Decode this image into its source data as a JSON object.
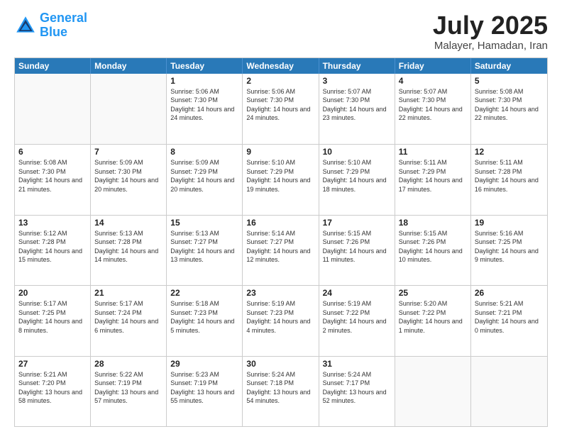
{
  "logo": {
    "line1": "General",
    "line2": "Blue"
  },
  "title": "July 2025",
  "location": "Malayer, Hamadan, Iran",
  "header_days": [
    "Sunday",
    "Monday",
    "Tuesday",
    "Wednesday",
    "Thursday",
    "Friday",
    "Saturday"
  ],
  "weeks": [
    [
      {
        "day": "",
        "info": ""
      },
      {
        "day": "",
        "info": ""
      },
      {
        "day": "1",
        "info": "Sunrise: 5:06 AM\nSunset: 7:30 PM\nDaylight: 14 hours and 24 minutes."
      },
      {
        "day": "2",
        "info": "Sunrise: 5:06 AM\nSunset: 7:30 PM\nDaylight: 14 hours and 24 minutes."
      },
      {
        "day": "3",
        "info": "Sunrise: 5:07 AM\nSunset: 7:30 PM\nDaylight: 14 hours and 23 minutes."
      },
      {
        "day": "4",
        "info": "Sunrise: 5:07 AM\nSunset: 7:30 PM\nDaylight: 14 hours and 22 minutes."
      },
      {
        "day": "5",
        "info": "Sunrise: 5:08 AM\nSunset: 7:30 PM\nDaylight: 14 hours and 22 minutes."
      }
    ],
    [
      {
        "day": "6",
        "info": "Sunrise: 5:08 AM\nSunset: 7:30 PM\nDaylight: 14 hours and 21 minutes."
      },
      {
        "day": "7",
        "info": "Sunrise: 5:09 AM\nSunset: 7:30 PM\nDaylight: 14 hours and 20 minutes."
      },
      {
        "day": "8",
        "info": "Sunrise: 5:09 AM\nSunset: 7:29 PM\nDaylight: 14 hours and 20 minutes."
      },
      {
        "day": "9",
        "info": "Sunrise: 5:10 AM\nSunset: 7:29 PM\nDaylight: 14 hours and 19 minutes."
      },
      {
        "day": "10",
        "info": "Sunrise: 5:10 AM\nSunset: 7:29 PM\nDaylight: 14 hours and 18 minutes."
      },
      {
        "day": "11",
        "info": "Sunrise: 5:11 AM\nSunset: 7:29 PM\nDaylight: 14 hours and 17 minutes."
      },
      {
        "day": "12",
        "info": "Sunrise: 5:11 AM\nSunset: 7:28 PM\nDaylight: 14 hours and 16 minutes."
      }
    ],
    [
      {
        "day": "13",
        "info": "Sunrise: 5:12 AM\nSunset: 7:28 PM\nDaylight: 14 hours and 15 minutes."
      },
      {
        "day": "14",
        "info": "Sunrise: 5:13 AM\nSunset: 7:28 PM\nDaylight: 14 hours and 14 minutes."
      },
      {
        "day": "15",
        "info": "Sunrise: 5:13 AM\nSunset: 7:27 PM\nDaylight: 14 hours and 13 minutes."
      },
      {
        "day": "16",
        "info": "Sunrise: 5:14 AM\nSunset: 7:27 PM\nDaylight: 14 hours and 12 minutes."
      },
      {
        "day": "17",
        "info": "Sunrise: 5:15 AM\nSunset: 7:26 PM\nDaylight: 14 hours and 11 minutes."
      },
      {
        "day": "18",
        "info": "Sunrise: 5:15 AM\nSunset: 7:26 PM\nDaylight: 14 hours and 10 minutes."
      },
      {
        "day": "19",
        "info": "Sunrise: 5:16 AM\nSunset: 7:25 PM\nDaylight: 14 hours and 9 minutes."
      }
    ],
    [
      {
        "day": "20",
        "info": "Sunrise: 5:17 AM\nSunset: 7:25 PM\nDaylight: 14 hours and 8 minutes."
      },
      {
        "day": "21",
        "info": "Sunrise: 5:17 AM\nSunset: 7:24 PM\nDaylight: 14 hours and 6 minutes."
      },
      {
        "day": "22",
        "info": "Sunrise: 5:18 AM\nSunset: 7:23 PM\nDaylight: 14 hours and 5 minutes."
      },
      {
        "day": "23",
        "info": "Sunrise: 5:19 AM\nSunset: 7:23 PM\nDaylight: 14 hours and 4 minutes."
      },
      {
        "day": "24",
        "info": "Sunrise: 5:19 AM\nSunset: 7:22 PM\nDaylight: 14 hours and 2 minutes."
      },
      {
        "day": "25",
        "info": "Sunrise: 5:20 AM\nSunset: 7:22 PM\nDaylight: 14 hours and 1 minute."
      },
      {
        "day": "26",
        "info": "Sunrise: 5:21 AM\nSunset: 7:21 PM\nDaylight: 14 hours and 0 minutes."
      }
    ],
    [
      {
        "day": "27",
        "info": "Sunrise: 5:21 AM\nSunset: 7:20 PM\nDaylight: 13 hours and 58 minutes."
      },
      {
        "day": "28",
        "info": "Sunrise: 5:22 AM\nSunset: 7:19 PM\nDaylight: 13 hours and 57 minutes."
      },
      {
        "day": "29",
        "info": "Sunrise: 5:23 AM\nSunset: 7:19 PM\nDaylight: 13 hours and 55 minutes."
      },
      {
        "day": "30",
        "info": "Sunrise: 5:24 AM\nSunset: 7:18 PM\nDaylight: 13 hours and 54 minutes."
      },
      {
        "day": "31",
        "info": "Sunrise: 5:24 AM\nSunset: 7:17 PM\nDaylight: 13 hours and 52 minutes."
      },
      {
        "day": "",
        "info": ""
      },
      {
        "day": "",
        "info": ""
      }
    ]
  ]
}
